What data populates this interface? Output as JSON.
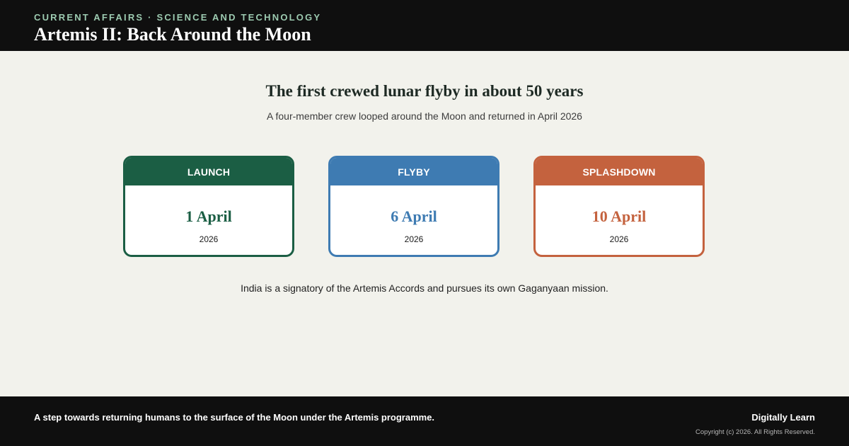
{
  "header": {
    "eyebrow": "CURRENT AFFAIRS · SCIENCE AND TECHNOLOGY",
    "title": "Artemis II: Back Around the Moon"
  },
  "main": {
    "headline": "The first crewed lunar flyby in about 50 years",
    "subheadline": "A four-member crew looped around the Moon and returned in April 2026",
    "cards": [
      {
        "label": "LAUNCH",
        "date": "1 April",
        "year": "2026",
        "color": "#1b5e44"
      },
      {
        "label": "FLYBY",
        "date": "6 April",
        "year": "2026",
        "color": "#3e7bb2"
      },
      {
        "label": "SPLASHDOWN",
        "date": "10 April",
        "year": "2026",
        "color": "#c4623e"
      }
    ],
    "note": "India is a signatory of the Artemis Accords and pursues its own Gaganyaan mission."
  },
  "footer": {
    "text": "A step towards returning humans to the surface of the Moon under the Artemis programme.",
    "brand": "Digitally Learn",
    "copyright": "Copyright (c) 2026. All Rights Reserved."
  },
  "colors": {
    "background": "#f2f2ec",
    "bar": "#0f0f0f",
    "eyebrow": "#9ccab0"
  }
}
